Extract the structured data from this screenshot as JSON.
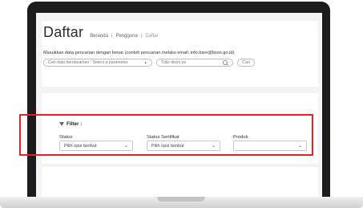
{
  "header": {
    "title": "Daftar",
    "breadcrumb": [
      "Beranda",
      "Pengguna",
      "Daftar"
    ]
  },
  "search": {
    "hint": "Masukkan data pencarian dengan benar (contoh pencarian melalui email: info.bsre@bssn.go.id)",
    "param_placeholder": "Cari data berdasarkan : Select a parameter",
    "query_placeholder": "Tulis disini ya",
    "button_label": "Cari"
  },
  "filter": {
    "title": "Filter :",
    "fields": [
      {
        "label": "Status",
        "value": "Pilih opsi berikut"
      },
      {
        "label": "Status Sertifikat",
        "value": "Pilih opsi berikut"
      },
      {
        "label": "Produk",
        "value": ""
      }
    ]
  },
  "colors": {
    "highlight": "#e0202a",
    "frame": "#1c1c1e"
  }
}
